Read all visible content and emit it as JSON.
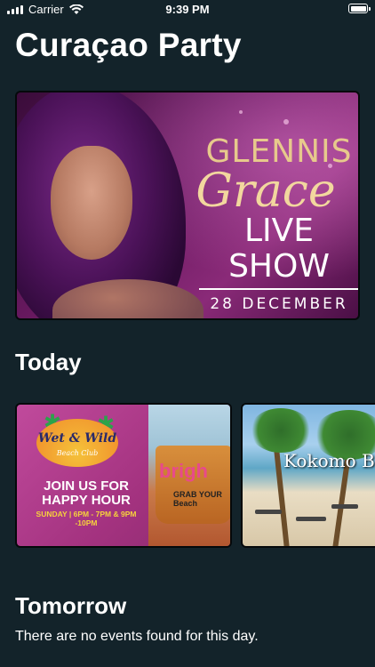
{
  "status_bar": {
    "carrier": "Carrier",
    "time": "9:39 PM",
    "battery_level": 1.0
  },
  "app": {
    "title": "Curaçao Party"
  },
  "featured": {
    "line1": "GLENNIS",
    "line2": "Grace",
    "line3": "LIVE SHOW",
    "date": "28 DECEMBER"
  },
  "sections": {
    "today": {
      "title": "Today",
      "cards": [
        {
          "logo_title": "Wet & Wild",
          "logo_subtitle": "Beach Club",
          "promo": "JOIN US FOR HAPPY HOUR",
          "times": "SUNDAY | 6PM - 7PM & 9PM -10PM",
          "brand": "brigh",
          "bucket_text": "GRAB YOUR Beach"
        },
        {
          "text": "Kokomo B Family I"
        }
      ]
    },
    "tomorrow": {
      "title": "Tomorrow",
      "empty_message": "There are no events found for this day."
    }
  },
  "colors": {
    "background": "#13232a",
    "text": "#ffffff"
  }
}
